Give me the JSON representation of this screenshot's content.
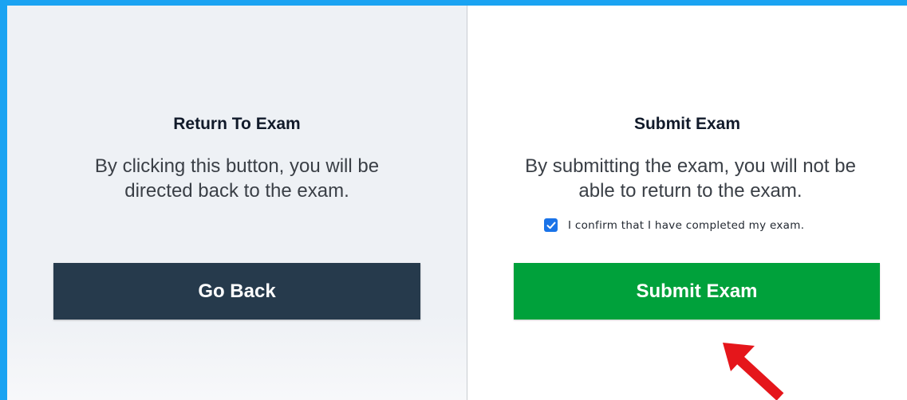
{
  "left_panel": {
    "title": "Return To Exam",
    "description": "By clicking this button, you will be directed back to the exam.",
    "button_label": "Go Back"
  },
  "right_panel": {
    "title": "Submit Exam",
    "description": "By submitting the exam, you will not be able to return to the exam.",
    "confirm_checked": true,
    "confirm_label": "I confirm that I have completed my exam.",
    "button_label": "Submit Exam"
  },
  "icons": {
    "checkbox": "check-icon",
    "annotation": "red-arrow-icon"
  },
  "colors": {
    "background_border": "#1aa3f2",
    "go_back_button": "#263a4c",
    "submit_button": "#00a13b",
    "checkbox": "#1a73e8",
    "annotation_arrow": "#e5161b"
  }
}
